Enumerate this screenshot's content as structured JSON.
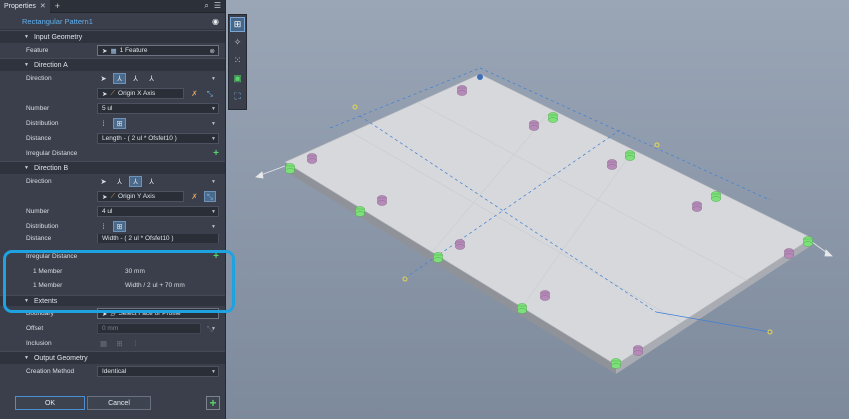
{
  "tabs": {
    "properties_label": "Properties"
  },
  "feature_name": "Rectangular Pattern1",
  "input_geometry": {
    "header": "Input Geometry",
    "feature_label": "Feature",
    "feature_value": "1 Feature"
  },
  "direction_a": {
    "header": "Direction A",
    "direction_label": "Direction",
    "axis_value": "Origin X Axis",
    "number_label": "Number",
    "number_value": "5 ul",
    "distribution_label": "Distribution",
    "distance_label": "Distance",
    "distance_value": "Length - ( 2 ul * Ofsfet10 )",
    "irregular_label": "Irregular Distance"
  },
  "direction_b": {
    "header": "Direction B",
    "direction_label": "Direction",
    "axis_value": "Origin Y Axis",
    "number_label": "Number",
    "number_value": "4 ul",
    "distribution_label": "Distribution",
    "distance_label": "Distance",
    "distance_value": "Width - ( 2 ul * Ofsfet10 )",
    "irregular_label": "Irregular Distance",
    "members": [
      {
        "label": "1 Member",
        "value": "30 mm"
      },
      {
        "label": "1 Member",
        "value": "Width / 2 ul + 70 mm"
      }
    ]
  },
  "extents": {
    "header": "Extents",
    "boundary_label": "Boundary",
    "boundary_value": "Select Face or Profile",
    "offset_label": "Offset",
    "offset_value": "0 mm",
    "inclusion_label": "Inclusion"
  },
  "output_geometry": {
    "header": "Output Geometry",
    "creation_label": "Creation Method",
    "creation_value": "Identical"
  },
  "buttons": {
    "ok": "OK",
    "cancel": "Cancel"
  },
  "colors": {
    "panel_bg": "#3a3f4b",
    "accent_blue": "#5fb0ef",
    "highlight": "#1fa3e0",
    "add_green": "#58d26b",
    "feature_purple": "#b58ab8",
    "feature_green": "#7ee07a"
  }
}
